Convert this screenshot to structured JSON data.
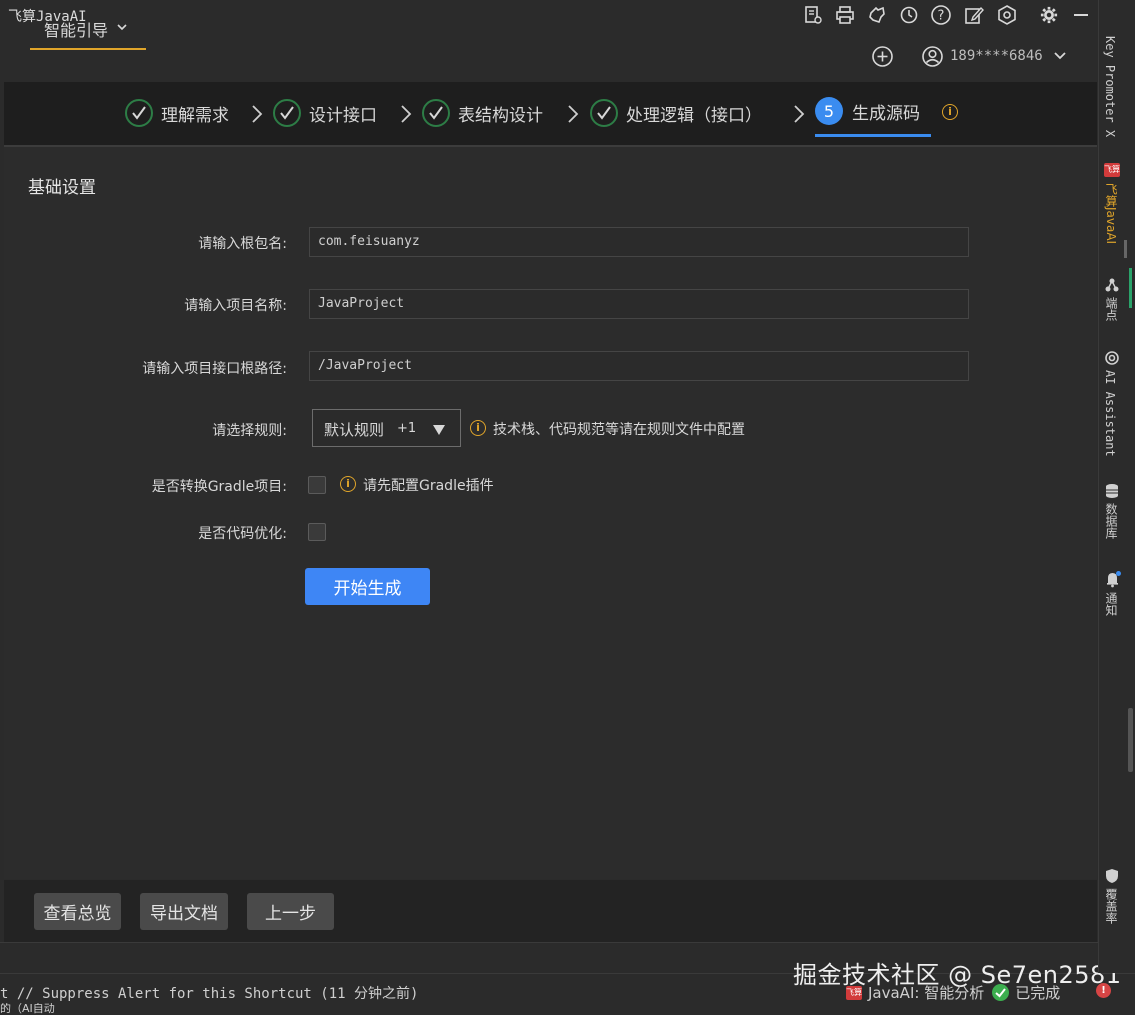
{
  "app": {
    "title": "飞算JavaAI"
  },
  "header": {
    "tab_label": "智能引导",
    "account": "189****6846"
  },
  "steps": [
    {
      "label": "理解需求",
      "state": "done"
    },
    {
      "label": "设计接口",
      "state": "done"
    },
    {
      "label": "表结构设计",
      "state": "done"
    },
    {
      "label": "处理逻辑（接口）",
      "state": "done"
    },
    {
      "label": "生成源码",
      "state": "active",
      "number": "5"
    }
  ],
  "section": {
    "title": "基础设置"
  },
  "form": {
    "package_label": "请输入根包名:",
    "package_value": "com.feisuanyz",
    "project_label": "请输入项目名称:",
    "project_value": "JavaProject",
    "path_label": "请输入项目接口根路径:",
    "path_value": "/JavaProject",
    "rule_label": "请选择规则:",
    "rule_value": "默认规则",
    "rule_extra": "+1",
    "rule_hint": "技术栈、代码规范等请在规则文件中配置",
    "gradle_label": "是否转换Gradle项目:",
    "gradle_hint": "请先配置Gradle插件",
    "gradle_checked": false,
    "optimize_label": "是否代码优化:",
    "optimize_checked": false,
    "start_button": "开始生成"
  },
  "footer": {
    "overview_button": "查看总览",
    "export_button": "导出文档",
    "prev_button": "上一步"
  },
  "status": {
    "message": "t // Suppress Alert for this Shortcut (11 分钟之前)",
    "cut_line": "的（AI自动",
    "plugin_badge": "飞算",
    "plugin_text": "JavaAI: 智能分析",
    "done_text": "已完成",
    "watermark": "掘金技术社区 @ Se7en2581"
  },
  "sidebar": {
    "key_promoter": "Key Promoter X",
    "feisuan_badge": "飞算",
    "feisuan": "飞算JavaAI",
    "endpoints": "端点",
    "ai_assistant": "AI Assistant",
    "database": "数据库",
    "notifications": "通知",
    "coverage": "覆盖率"
  },
  "colors": {
    "accent_blue": "#3e86f5",
    "accent_orange": "#e0a52a",
    "check_green": "#2d7d46"
  }
}
